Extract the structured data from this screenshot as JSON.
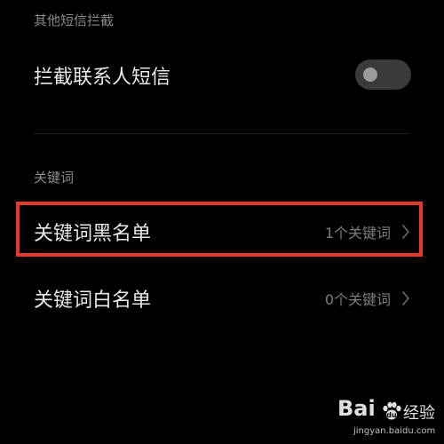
{
  "sections": {
    "other_intercept": {
      "header": "其他短信拦截",
      "intercept_contacts": {
        "label": "拦截联系人短信",
        "enabled": false
      }
    },
    "keywords": {
      "header": "关键词",
      "blacklist": {
        "label": "关键词黑名单",
        "value": "1个关键词"
      },
      "whitelist": {
        "label": "关键词白名单",
        "value": "0个关键词"
      }
    }
  },
  "watermark": {
    "logo": "Bai",
    "text": "经验",
    "url": "jingyan.baidu.com"
  },
  "colors": {
    "background": "#000000",
    "highlight": "#e53a2b",
    "toggle_track": "#3a3a3a",
    "toggle_knob": "#9b9b9b"
  }
}
